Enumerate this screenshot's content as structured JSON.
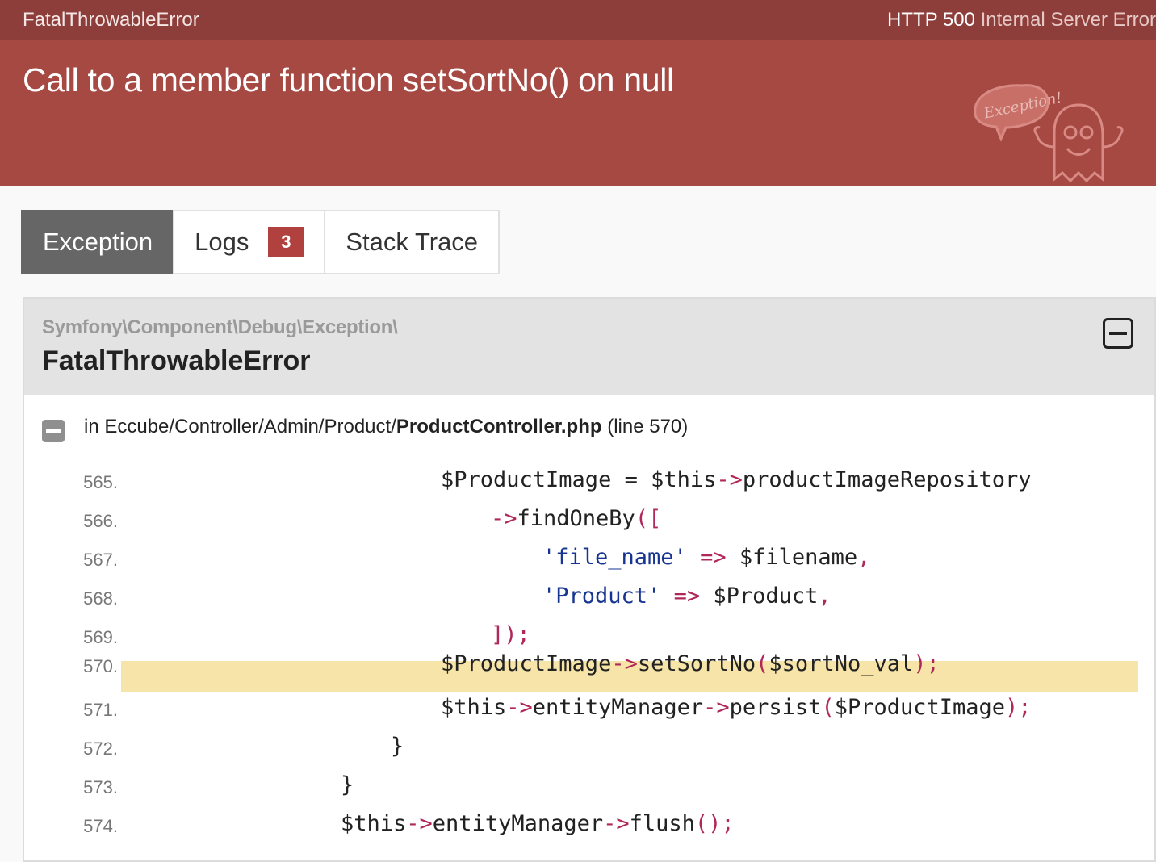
{
  "topbar": {
    "exception_class": "FatalThrowableError",
    "status_code": "HTTP 500",
    "status_text": "Internal Server Error"
  },
  "header": {
    "message": "Call to a member function setSortNo() on null",
    "ghost_bubble": "Exception!"
  },
  "tabs": [
    {
      "label": "Exception",
      "active": true
    },
    {
      "label": "Logs",
      "badge": "3"
    },
    {
      "label": "Stack Trace"
    }
  ],
  "exception": {
    "namespace": "Symfony\\Component\\Debug\\Exception\\",
    "class": "FatalThrowableError",
    "location_prefix": "in Eccube/Controller/Admin/Product/",
    "location_file": "ProductController.php",
    "location_line": "(line 570)"
  },
  "code_lines": [
    {
      "no": "565.",
      "t": [
        "$ProductImage ",
        "= ",
        "$this",
        "->",
        "productImageRepository"
      ]
    },
    {
      "no": "566.",
      "t": [
        "->",
        "findOneBy",
        "([",
        "",
        ""
      ]
    },
    {
      "no": "567.",
      "t": [
        "'file_name'",
        " => ",
        "$filename",
        ",",
        ""
      ]
    },
    {
      "no": "568.",
      "t": [
        "'Product'",
        " => ",
        "$Product",
        ",",
        ""
      ]
    },
    {
      "no": "569.",
      "t": [
        "]);",
        "",
        "",
        "",
        ""
      ]
    },
    {
      "no": "570.",
      "t": [
        "$ProductImage",
        "->",
        "setSortNo",
        "(",
        "$sortNo_val",
        ");"
      ]
    },
    {
      "no": "571.",
      "t": [
        "$this",
        "->",
        "entityManager",
        "->",
        "persist",
        "(",
        "$ProductImage",
        ");"
      ]
    },
    {
      "no": "572.",
      "t": [
        "}"
      ]
    },
    {
      "no": "573.",
      "t": [
        "}"
      ]
    },
    {
      "no": "574.",
      "t": [
        "$this",
        "->",
        "entityManager",
        "->",
        "flush",
        "();"
      ]
    }
  ],
  "colors": {
    "keyword": "#b0275a",
    "string": "#183691",
    "highlight": "#f7e4a8",
    "brand": "#a64943"
  }
}
